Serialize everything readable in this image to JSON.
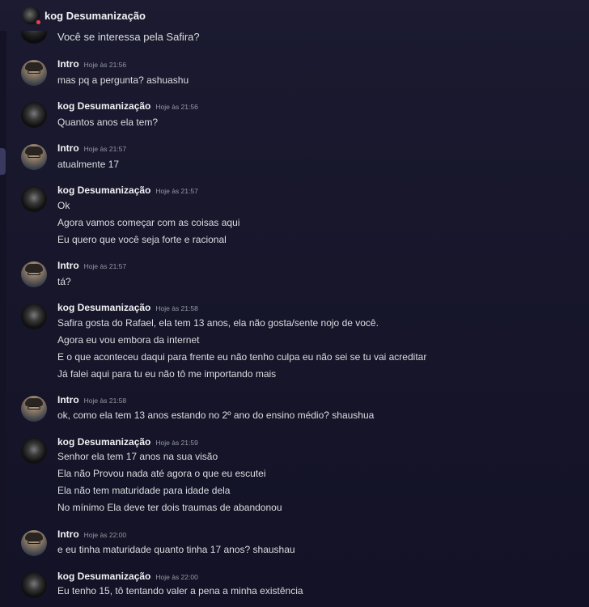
{
  "channel": {
    "title": "kog Desumanização"
  },
  "previous_message": {
    "text": "Você se interessa pela Safira?"
  },
  "messages": [
    {
      "author": "Intro",
      "time": "Hoje às 21:56",
      "lines": [
        "mas pq a pergunta? ashuashu"
      ]
    },
    {
      "author": "kog Desumanização",
      "time": "Hoje às 21:56",
      "lines": [
        "Quantos anos ela tem?"
      ]
    },
    {
      "author": "Intro",
      "time": "Hoje às 21:57",
      "lines": [
        "atualmente 17"
      ]
    },
    {
      "author": "kog Desumanização",
      "time": "Hoje às 21:57",
      "lines": [
        "Ok",
        "Agora vamos começar com as coisas aqui",
        "Eu quero que você seja forte e racional"
      ]
    },
    {
      "author": "Intro",
      "time": "Hoje às 21:57",
      "lines": [
        "tá?"
      ]
    },
    {
      "author": "kog Desumanização",
      "time": "Hoje às 21:58",
      "lines": [
        "Safira gosta do Rafael, ela tem 13 anos, ela não gosta/sente nojo de você.",
        "Agora eu vou embora da internet",
        "E o que aconteceu daqui para frente eu não tenho culpa eu não sei se tu vai acreditar",
        "Já falei aqui para tu eu não tô me importando mais"
      ]
    },
    {
      "author": "Intro",
      "time": "Hoje às 21:58",
      "lines": [
        "ok, como ela tem 13 anos estando no 2º ano do ensino médio? shaushua"
      ]
    },
    {
      "author": "kog Desumanização",
      "time": "Hoje às 21:59",
      "lines": [
        "Senhor ela tem 17 anos na sua visão",
        "Ela não Provou nada até agora o que eu escutei",
        "Ela não tem maturidade para idade dela",
        "No mínimo Ela deve ter dois traumas de abandonou"
      ]
    },
    {
      "author": "Intro",
      "time": "Hoje às 22:00",
      "lines": [
        "e eu tinha maturidade quanto tinha 17 anos? shaushau"
      ]
    },
    {
      "author": "kog Desumanização",
      "time": "Hoje às 22:00",
      "lines": [
        "Eu tenho 15, tô tentando valer a pena a minha existência"
      ]
    }
  ],
  "colors": {
    "background": "#1b1a30",
    "text": "#dbdee1",
    "username": "#f2f3f5",
    "timestamp": "#949ba4",
    "status_dnd": "#f23f43"
  }
}
